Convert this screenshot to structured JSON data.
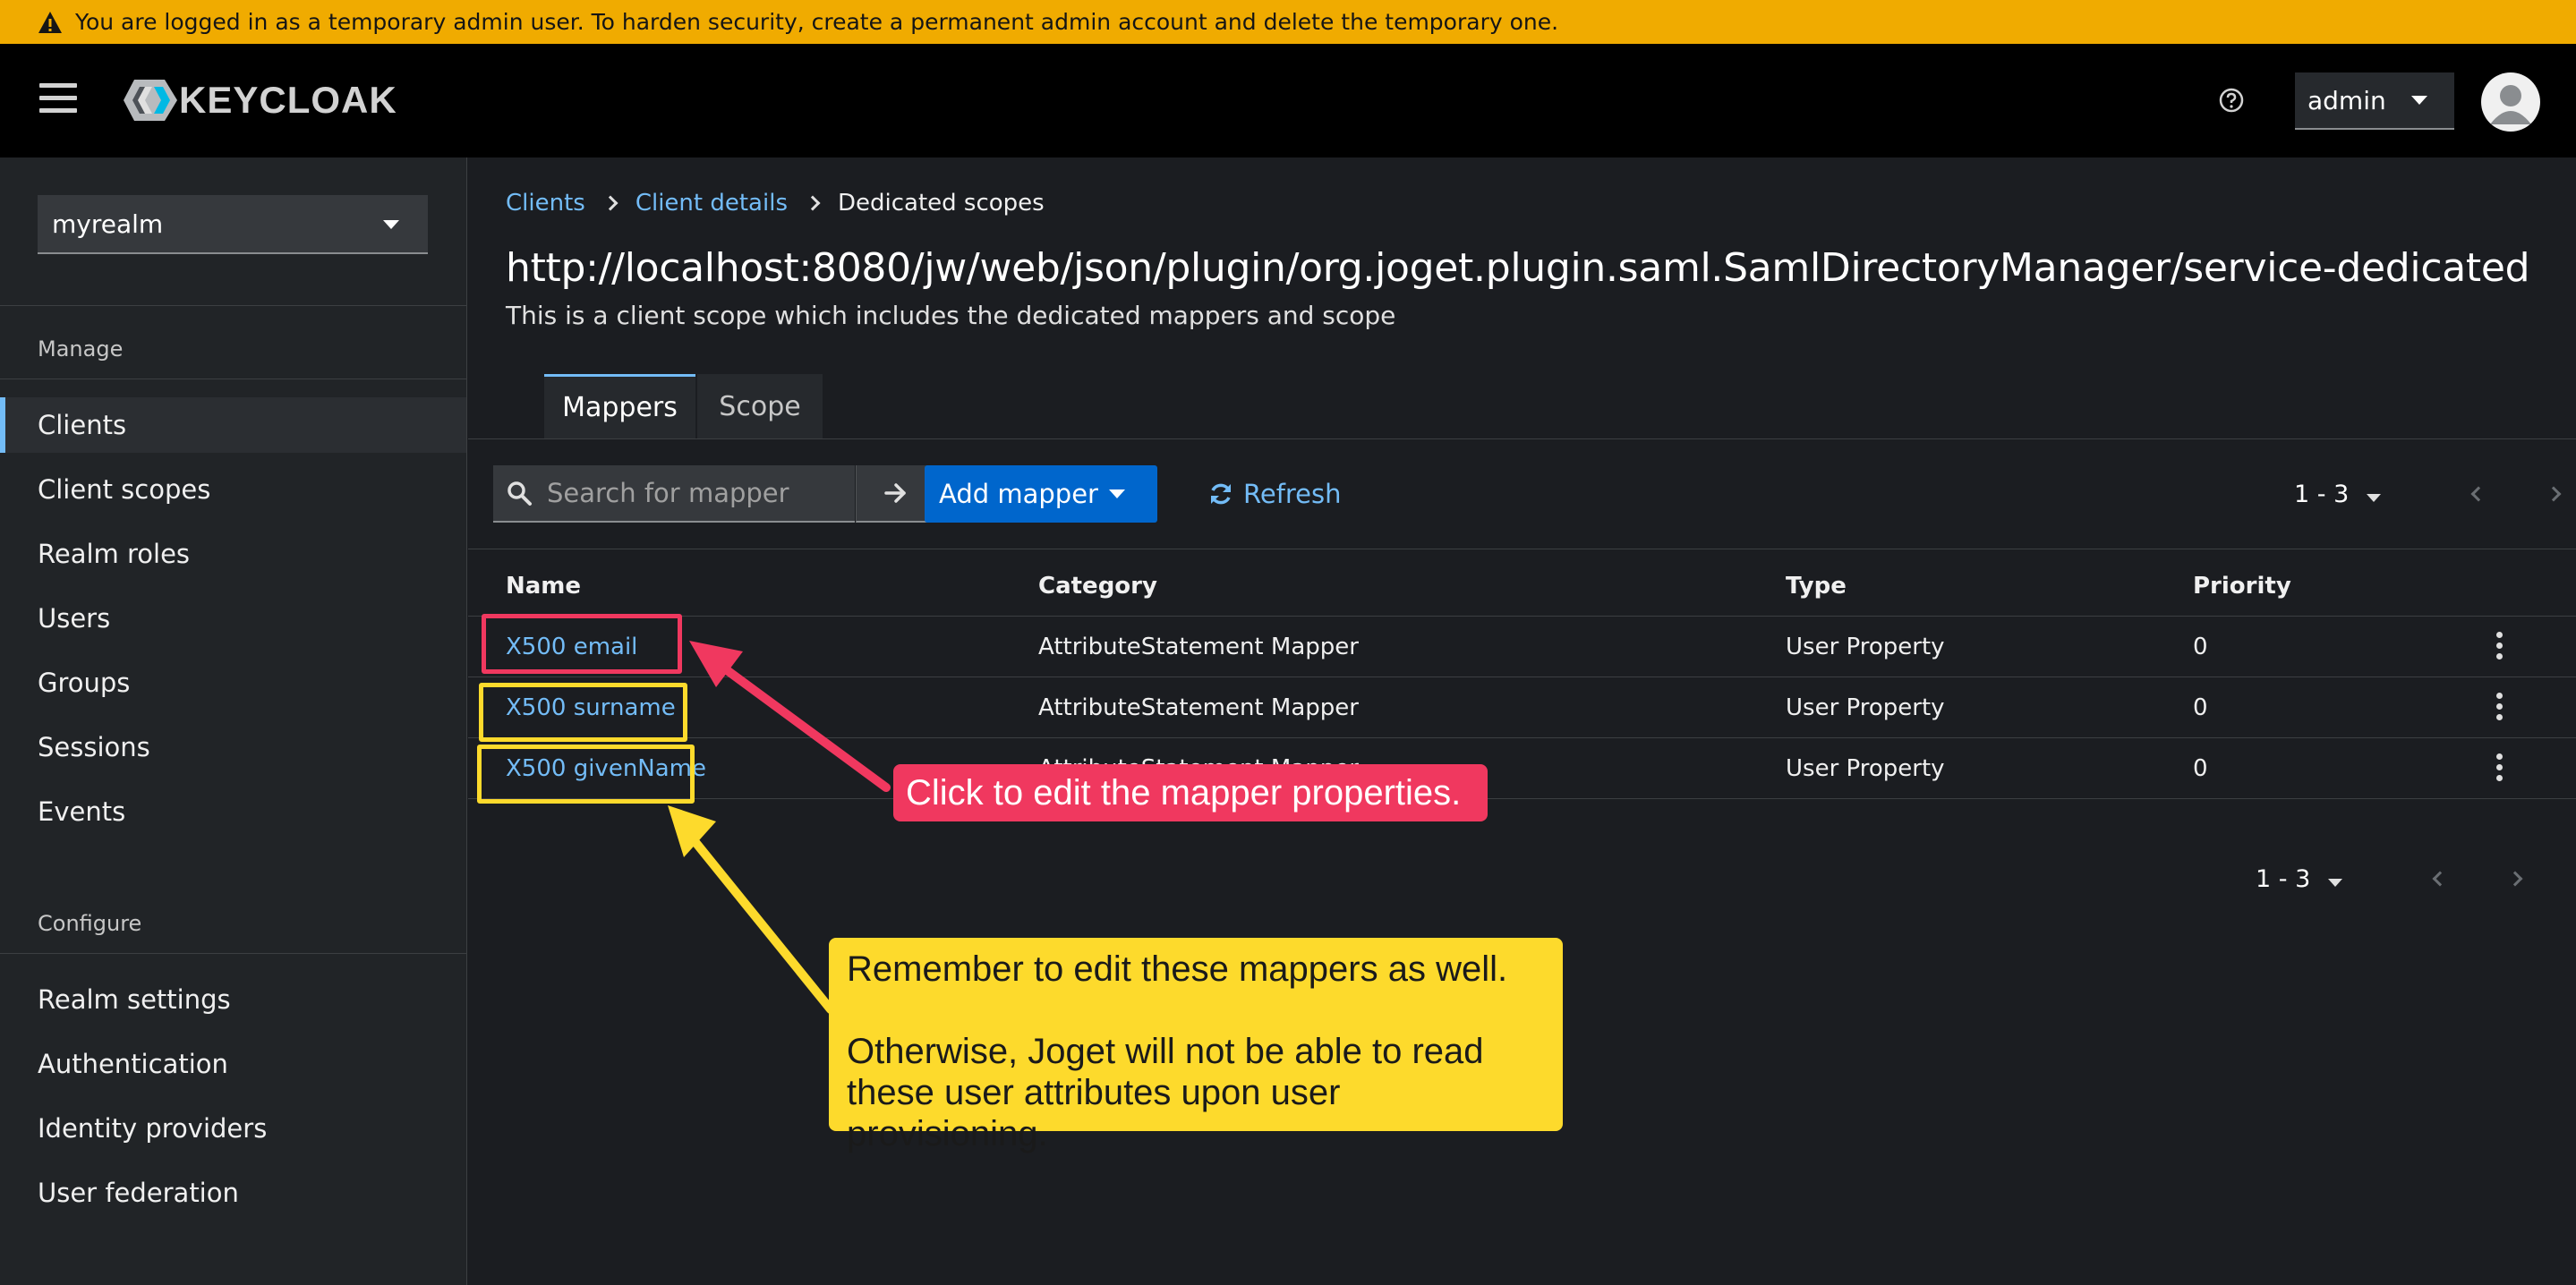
{
  "banner": {
    "text": "You are logged in as a temporary admin user. To harden security, create a permanent admin account and delete the temporary one."
  },
  "masthead": {
    "logo_text": "KEYCLOAK",
    "user": "admin"
  },
  "sidebar": {
    "realm": "myrealm",
    "manage_label": "Manage",
    "manage_items": [
      {
        "label": "Clients",
        "active": true
      },
      {
        "label": "Client scopes"
      },
      {
        "label": "Realm roles"
      },
      {
        "label": "Users"
      },
      {
        "label": "Groups"
      },
      {
        "label": "Sessions"
      },
      {
        "label": "Events"
      }
    ],
    "configure_label": "Configure",
    "configure_items": [
      {
        "label": "Realm settings"
      },
      {
        "label": "Authentication"
      },
      {
        "label": "Identity providers"
      },
      {
        "label": "User federation"
      }
    ]
  },
  "breadcrumb": {
    "items": [
      "Clients",
      "Client details"
    ],
    "current": "Dedicated scopes"
  },
  "page": {
    "title": "http://localhost:8080/jw/web/json/plugin/org.joget.plugin.saml.SamlDirectoryManager/service-dedicated",
    "description": "This is a client scope which includes the dedicated mappers and scope"
  },
  "tabs": [
    "Mappers",
    "Scope"
  ],
  "toolbar": {
    "search_placeholder": "Search for mapper",
    "add_label": "Add mapper",
    "refresh_label": "Refresh",
    "pagination": "1 - 3"
  },
  "table": {
    "columns": [
      "Name",
      "Category",
      "Type",
      "Priority"
    ],
    "rows": [
      {
        "name": "X500 email",
        "category": "AttributeStatement Mapper",
        "type": "User Property",
        "priority": "0"
      },
      {
        "name": "X500 surname",
        "category": "AttributeStatement Mapper",
        "type": "User Property",
        "priority": "0"
      },
      {
        "name": "X500 givenName",
        "category": "AttributeStatement Mapper",
        "type": "User Property",
        "priority": "0"
      }
    ]
  },
  "annotations": {
    "red": "Click to edit the mapper properties.",
    "yellow_line1": "Remember to edit these mappers as well.",
    "yellow_line2": "Otherwise, Joget will not be able to read these user attributes upon user provisioning.",
    "red_color": "#f0385f",
    "yellow_color": "#fdda2c"
  },
  "colors": {
    "banner": "#f0ab00",
    "link": "#73bcf7",
    "primary_button": "#0066cc",
    "background": "#1b1d21"
  }
}
